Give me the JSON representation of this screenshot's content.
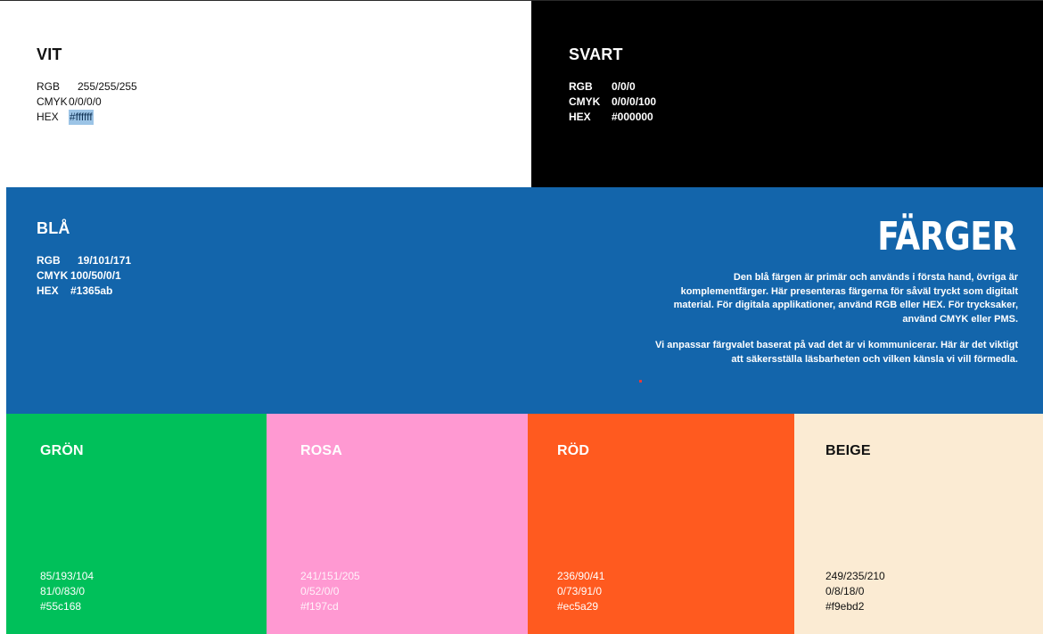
{
  "white": {
    "title": "VIT",
    "rgb_label": "RGB",
    "rgb": "255/255/255",
    "cmyk_label": "CMYK",
    "cmyk": "0/0/0/0",
    "hex_label": "HEX",
    "hex": "#ffffff",
    "color": "#ffffff"
  },
  "black": {
    "title": "SVART",
    "rgb_label": "RGB",
    "rgb": "0/0/0",
    "cmyk_label": "CMYK",
    "cmyk": "0/0/0/100",
    "hex_label": "HEX",
    "hex": "#000000",
    "color": "#000000"
  },
  "blue": {
    "title": "BLÅ",
    "rgb_label": "RGB",
    "rgb": "19/101/171",
    "cmyk_label": "CMYK",
    "cmyk": "100/50/0/1",
    "hex_label": "HEX",
    "hex": "#1365ab",
    "color": "#1365ab"
  },
  "heading": "FÄRGER",
  "description": {
    "p1": "Den blå färgen är primär och används i första hand, övriga är komplementfärger. Här presenteras färgerna för såväl tryckt som digitalt material. För digitala applikationer, använd RGB eller HEX. För trycksaker, använd CMYK eller PMS.",
    "p2": "Vi anpassar färgvalet baserat på vad det är vi kommunicerar. Här är det viktigt att säkersställa läsbarheten och vilken känsla vi vill förmedla."
  },
  "green": {
    "title": "GRÖN",
    "rgb": "85/193/104",
    "cmyk": "81/0/83/0",
    "hex": "#55c168",
    "color": "#55c168"
  },
  "pink": {
    "title": "ROSA",
    "rgb": "241/151/205",
    "cmyk": "0/52/0/0",
    "hex": "#f197cd",
    "color": "#f197cd"
  },
  "red": {
    "title": "RÖD",
    "rgb": "236/90/41",
    "cmyk": "0/73/91/0",
    "hex": "#ec5a29",
    "color": "#ec5a29"
  },
  "beige": {
    "title": "BEIGE",
    "rgb": "249/235/210",
    "cmyk": "0/8/18/0",
    "hex": "#f9ebd2",
    "color": "#f9ebd2"
  }
}
